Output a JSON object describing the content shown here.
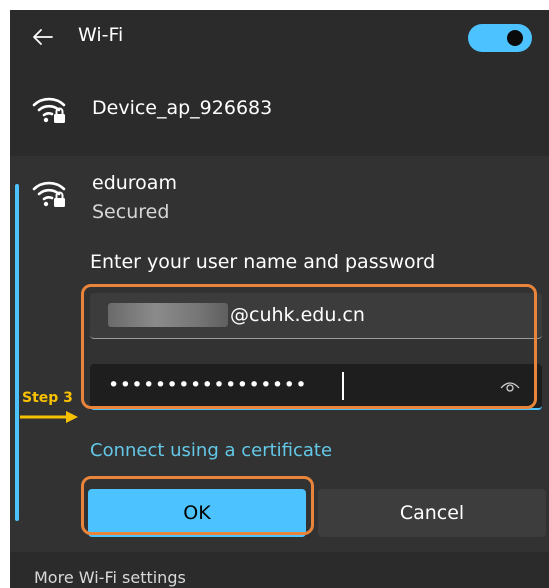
{
  "header": {
    "title": "Wi-Fi",
    "wifi_enabled": true
  },
  "networks": [
    {
      "name": "Device_ap_926683",
      "icon": "wifi-lock-icon"
    },
    {
      "name": "eduroam",
      "status": "Secured",
      "icon": "wifi-lock-icon"
    }
  ],
  "login": {
    "prompt": "Enter your user name and password",
    "username_visible": "@cuhk.edu.cn",
    "password_masked": "•••••••••••••••••",
    "reveal_icon": "eye-icon",
    "cert_link": "Connect using a certificate",
    "ok_label": "OK",
    "cancel_label": "Cancel"
  },
  "footer": {
    "more_settings": "More Wi-Fi settings"
  },
  "annotation": {
    "step_label": "Step 3",
    "color": "#e8853a"
  },
  "colors": {
    "accent": "#4cc2ff",
    "panel": "#2b2b2b",
    "link": "#63c8e8"
  }
}
